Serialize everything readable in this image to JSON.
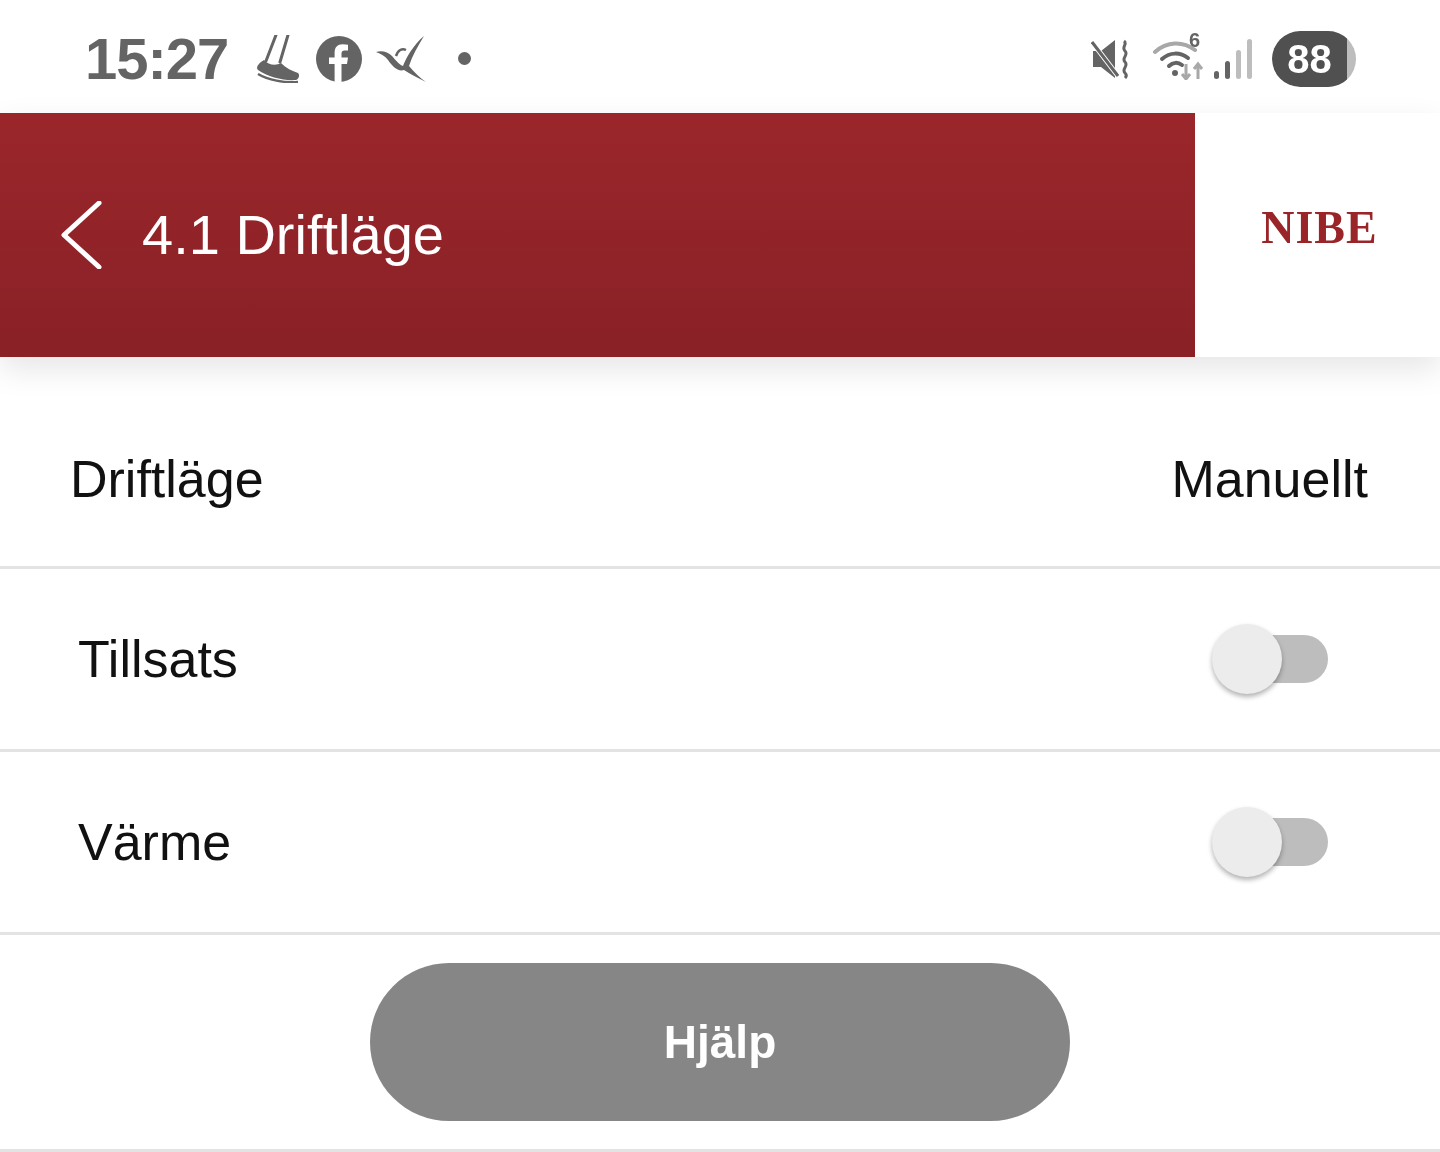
{
  "status_bar": {
    "time": "15:27",
    "wifi_label": "6",
    "battery": "88"
  },
  "header": {
    "title": "4.1 Driftläge",
    "logo": "NIBE"
  },
  "settings": [
    {
      "kind": "value",
      "label": "Driftläge",
      "value": "Manuellt"
    },
    {
      "kind": "toggle",
      "label": "Tillsats",
      "on": false
    },
    {
      "kind": "toggle",
      "label": "Värme",
      "on": false
    }
  ],
  "help_button": {
    "label": "Hjälp"
  }
}
